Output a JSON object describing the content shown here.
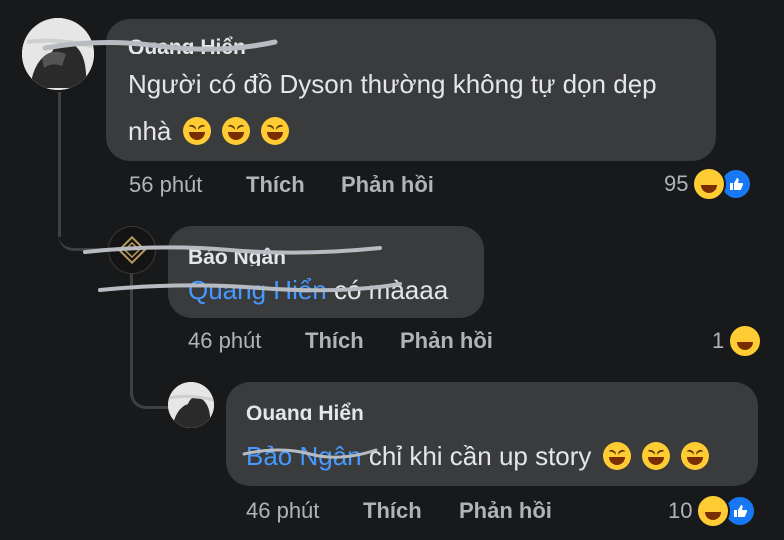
{
  "comments": [
    {
      "author": "Quang Hiển",
      "text_line1": "Người có đồ Dyson thường không tự dọn dẹp",
      "text_line2": "nhà",
      "time": "56 phút",
      "like_label": "Thích",
      "reply_label": "Phản hồi",
      "reaction_count": "95"
    },
    {
      "author": "Bảo Ngân",
      "mention": "Quang Hiển",
      "text": " có màaaa",
      "time": "46 phút",
      "like_label": "Thích",
      "reply_label": "Phản hồi",
      "reaction_count": "1"
    },
    {
      "author": "Quang Hiển",
      "mention": "Bảo Ngân",
      "text": " chỉ khi cần up story",
      "time": "46 phút",
      "like_label": "Thích",
      "reply_label": "Phản hồi",
      "reaction_count": "10"
    }
  ],
  "icons": {
    "emoji": "laughing-emoji-icon",
    "like": "like-reaction-icon",
    "haha": "haha-reaction-icon"
  }
}
